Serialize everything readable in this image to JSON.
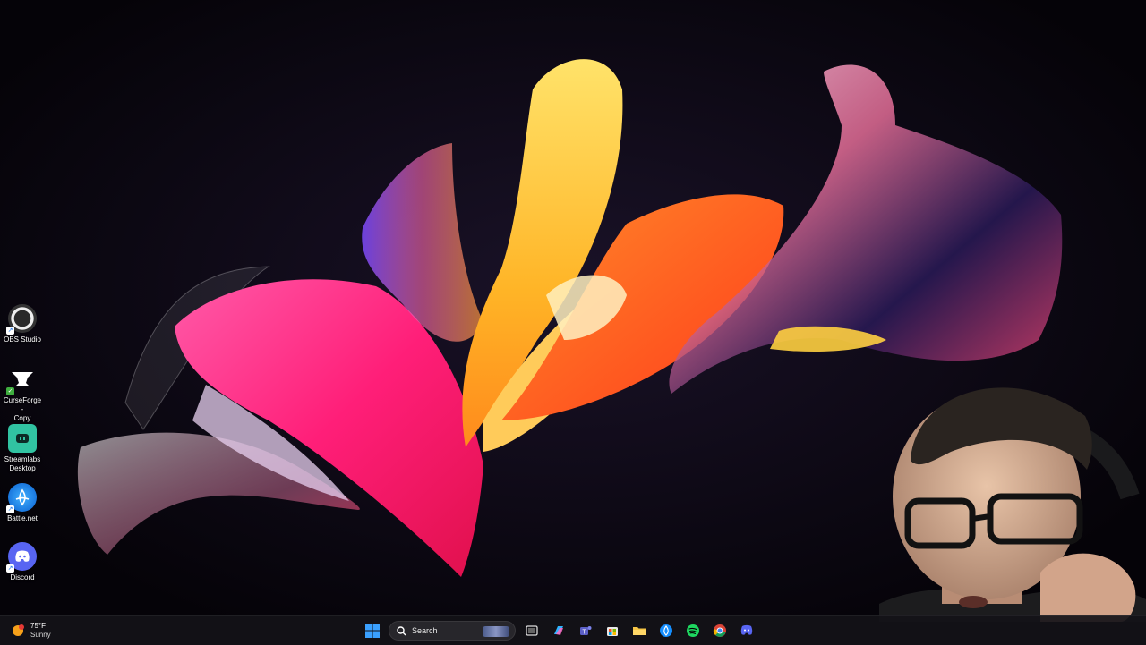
{
  "desktop": {
    "icons": [
      {
        "label": "OBS Studio",
        "icon": "obs-icon"
      },
      {
        "label": "CurseForge -\nCopy",
        "icon": "curseforge-icon"
      },
      {
        "label": "Streamlabs\nDesktop",
        "icon": "streamlabs-icon"
      },
      {
        "label": "Battle.net",
        "icon": "battlenet-icon"
      },
      {
        "label": "Discord",
        "icon": "discord-icon"
      }
    ]
  },
  "taskbar": {
    "weather": {
      "temp": "75°F",
      "condition": "Sunny",
      "icon": "sun-icon"
    },
    "search_label": "Search",
    "pinned": [
      "start-icon",
      "task-view-icon",
      "copilot-icon",
      "teams-icon",
      "store-icon",
      "file-explorer-icon",
      "battlenet-icon",
      "spotify-icon",
      "chrome-icon",
      "discord-icon"
    ]
  },
  "colors": {
    "background": "#07050d",
    "taskbar": "#141218",
    "accent": "#0078d4"
  }
}
